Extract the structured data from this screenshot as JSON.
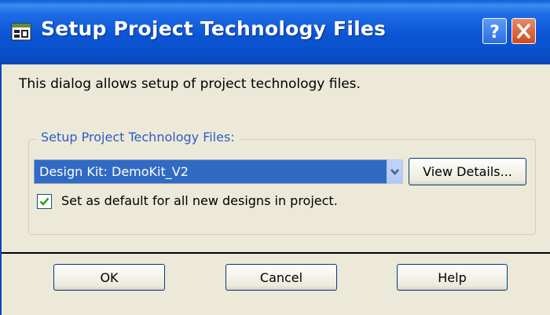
{
  "dialog": {
    "title": "Setup Project Technology Files",
    "description": "This dialog allows setup of project technology files.",
    "title_icon": "window-app-icon"
  },
  "group": {
    "label": "Setup Project Technology Files:",
    "select_value": "Design Kit: DemoKit_V2",
    "view_details_label": "View Details...",
    "checkbox_label": "Set as default for all new designs in project.",
    "checkbox_checked": true
  },
  "buttons": {
    "ok": "OK",
    "cancel": "Cancel",
    "help": "Help"
  },
  "colors": {
    "titlebar": "#0a55d0",
    "dialog_bg": "#ece9d8",
    "selection": "#316ac5",
    "group_label": "#2f5bc8",
    "close_button": "#d24a1c"
  }
}
